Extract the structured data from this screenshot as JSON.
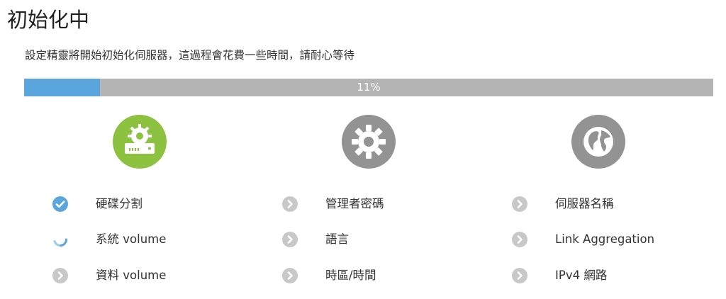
{
  "title": "初始化中",
  "description": "設定精靈將開始初始化伺服器，這過程會花費一些時間，請耐心等待",
  "progress": {
    "percent": 11,
    "label": "11%"
  },
  "colors": {
    "progress_fill": "#5aa5de",
    "progress_track": "#b4b4b4",
    "stage_active": "#8cc23f",
    "stage_idle": "#939393",
    "step_done": "#5aa5de",
    "step_pending": "#c8c8c8"
  },
  "stages": [
    {
      "icon": "server-gear-icon",
      "state": "active",
      "steps": [
        {
          "label": "硬碟分割",
          "status": "done"
        },
        {
          "label": "系統 volume",
          "status": "in-progress"
        },
        {
          "label": "資料 volume",
          "status": "pending"
        }
      ]
    },
    {
      "icon": "gear-icon",
      "state": "idle",
      "steps": [
        {
          "label": "管理者密碼",
          "status": "pending"
        },
        {
          "label": "語言",
          "status": "pending"
        },
        {
          "label": "時區/時間",
          "status": "pending"
        }
      ]
    },
    {
      "icon": "globe-icon",
      "state": "idle",
      "steps": [
        {
          "label": "伺服器名稱",
          "status": "pending"
        },
        {
          "label": "Link Aggregation",
          "status": "pending"
        },
        {
          "label": "IPv4 網路",
          "status": "pending"
        }
      ]
    }
  ]
}
